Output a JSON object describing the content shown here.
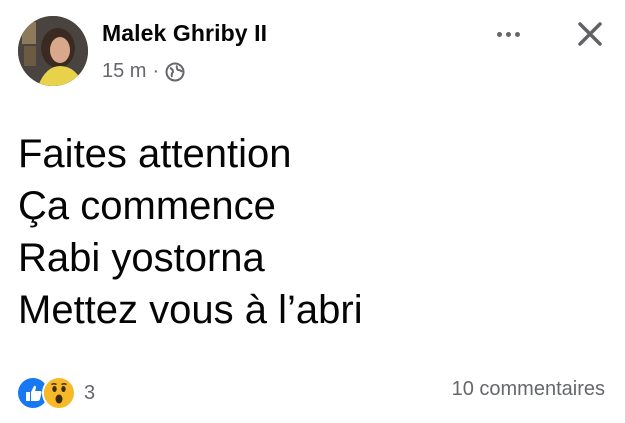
{
  "post": {
    "author": "Malek Ghriby II",
    "time": "15 m",
    "separator": "·",
    "privacy_icon": "globe-icon",
    "body_lines": [
      "Faites attention",
      "Ça commence",
      "Rabi yostorna",
      "Mettez vous à l’abri"
    ]
  },
  "header_actions": {
    "more_icon": "more-options-icon",
    "close_icon": "close-icon"
  },
  "footer": {
    "reaction_icons": [
      "like-icon",
      "wow-icon"
    ],
    "reaction_count": "3",
    "comments": "10 commentaires"
  },
  "colors": {
    "text_primary": "#050505",
    "text_secondary": "#65676b",
    "like_blue": "#1877f2",
    "wow_yellow": "#f7b928"
  }
}
